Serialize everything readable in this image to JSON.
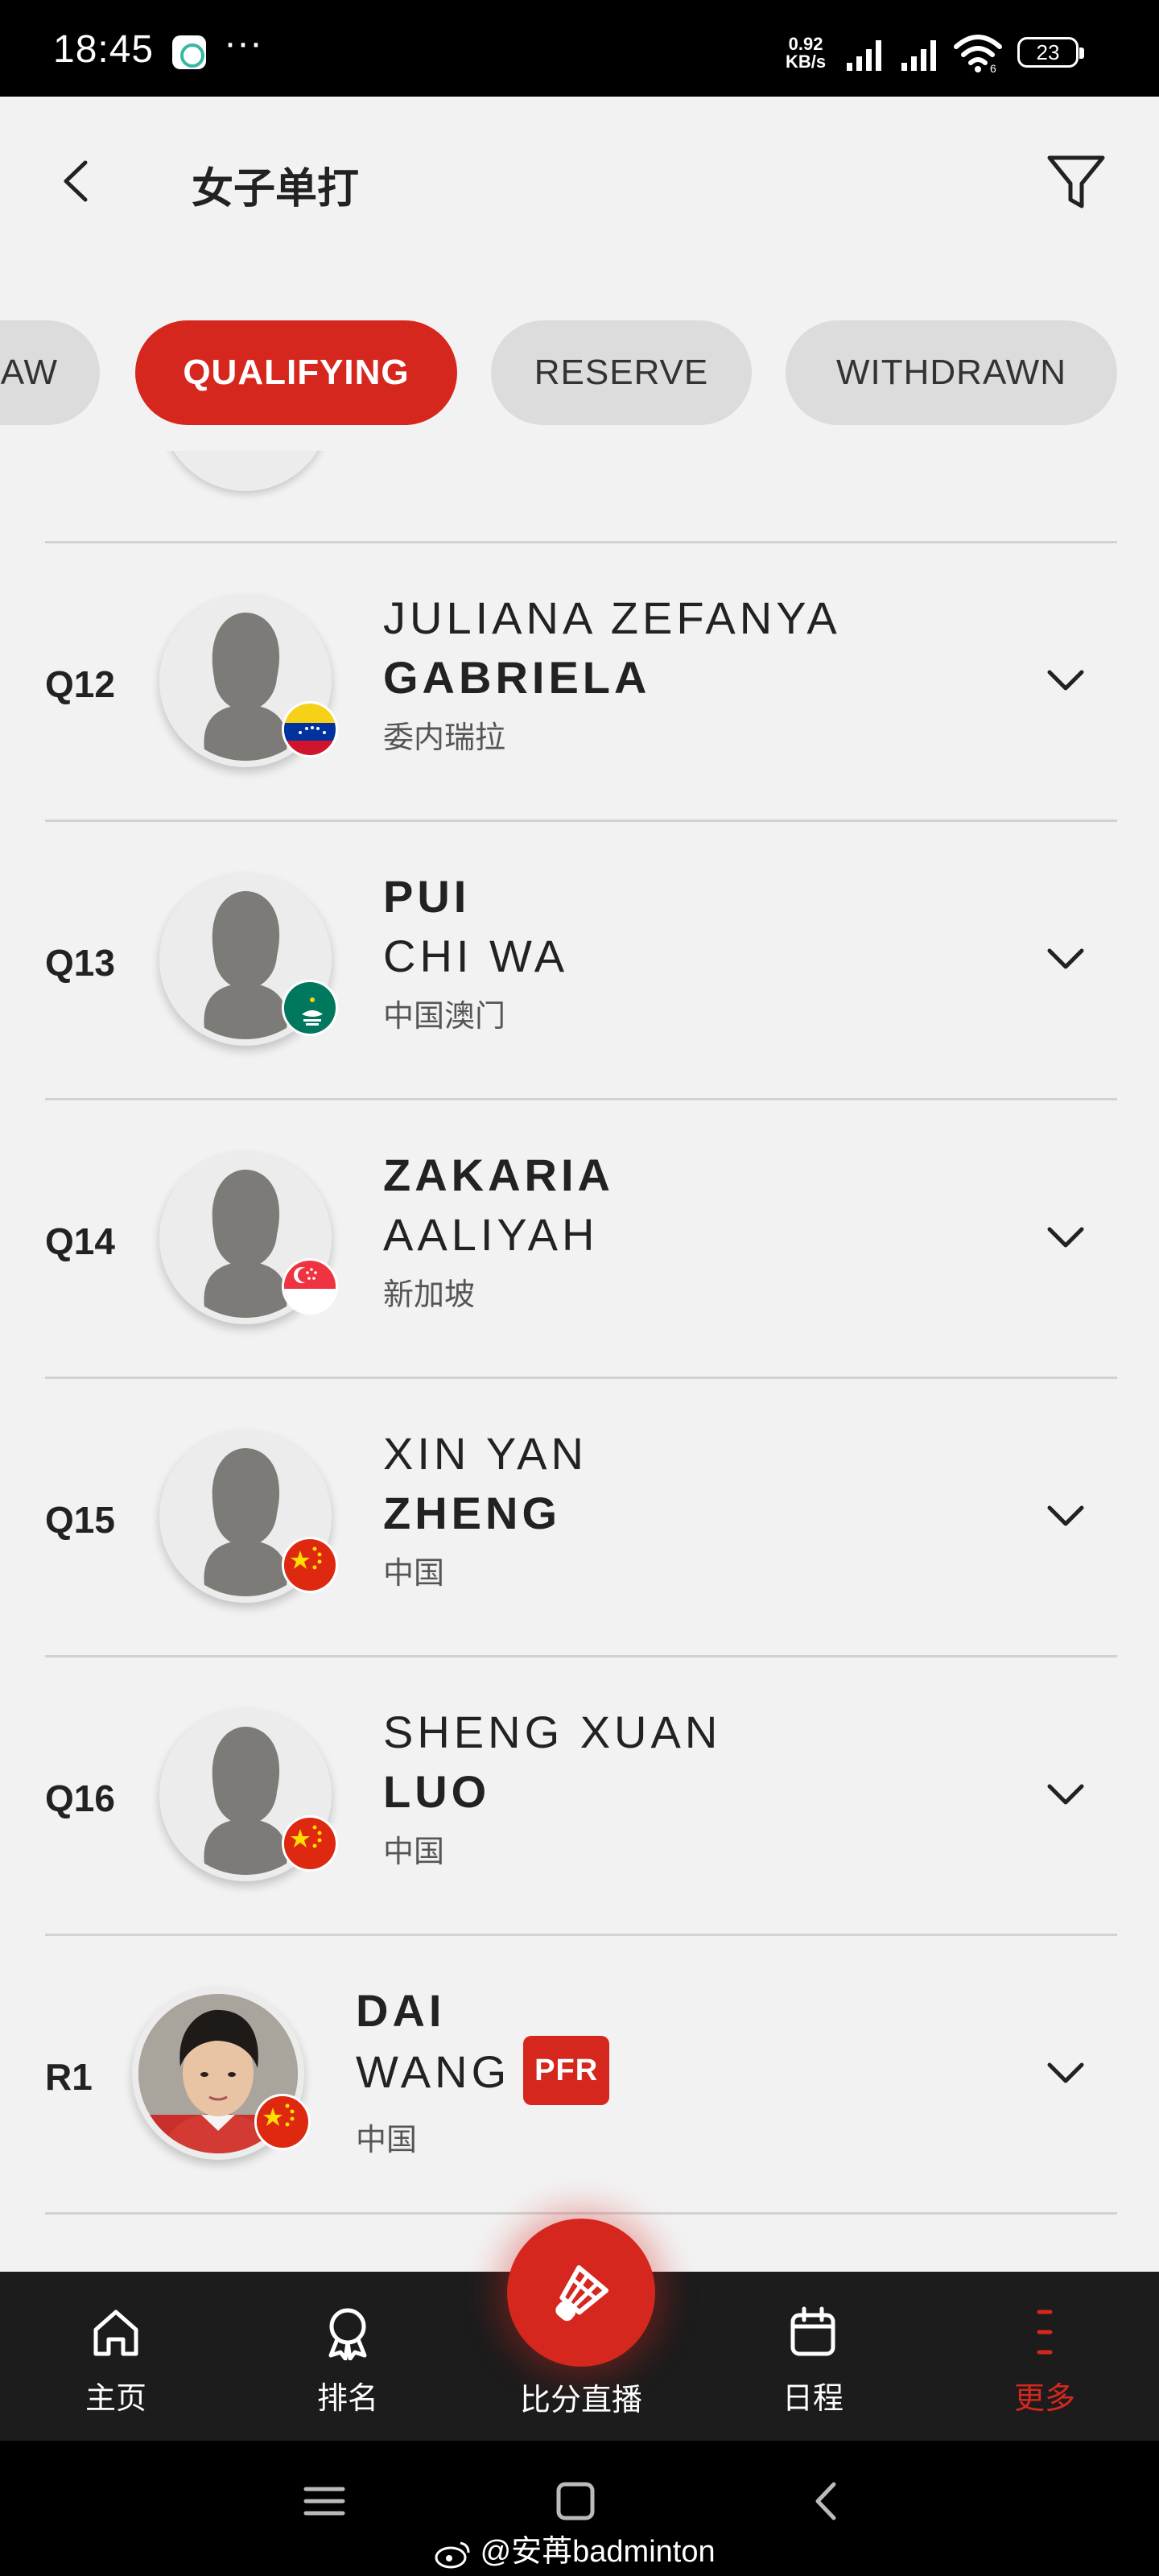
{
  "status_bar": {
    "time": "18:45",
    "dots": "···",
    "speed_value": "0.92",
    "speed_unit": "KB/s",
    "battery": "23",
    "wifi_label": "6"
  },
  "header": {
    "title": "女子单打"
  },
  "tabs": [
    {
      "label": "AW",
      "active": false
    },
    {
      "label": "QUALIFYING",
      "active": true
    },
    {
      "label": "RESERVE",
      "active": false
    },
    {
      "label": "WITHDRAWN",
      "active": false
    }
  ],
  "players": [
    {
      "seed": "Q12",
      "line1": "JULIANA ZEFANYA",
      "line2": "GABRIELA",
      "country": "委内瑞拉",
      "flag": "venezuela"
    },
    {
      "seed": "Q13",
      "line1": "PUI",
      "line2": "CHI WA",
      "country": "中国澳门",
      "flag": "macau"
    },
    {
      "seed": "Q14",
      "line1": "ZAKARIA",
      "line2": "AALIYAH",
      "country": "新加坡",
      "flag": "singapore"
    },
    {
      "seed": "Q15",
      "line1": "XIN YAN",
      "line2": "ZHENG",
      "country": "中国",
      "flag": "china"
    },
    {
      "seed": "Q16",
      "line1": "SHENG XUAN",
      "line2": "LUO",
      "country": "中国",
      "flag": "china"
    },
    {
      "seed": "R1",
      "line1": "DAI",
      "line2": "WANG",
      "country": "中国",
      "flag": "china",
      "badge": "PFR"
    }
  ],
  "bottom_nav": {
    "home": "主页",
    "ranking": "排名",
    "live": "比分直播",
    "schedule": "日程",
    "more": "更多"
  },
  "watermark": "@安苒badminton",
  "colors": {
    "accent": "#d6271f",
    "background": "#f2f2f2",
    "nav_background": "#1c1c1c"
  }
}
